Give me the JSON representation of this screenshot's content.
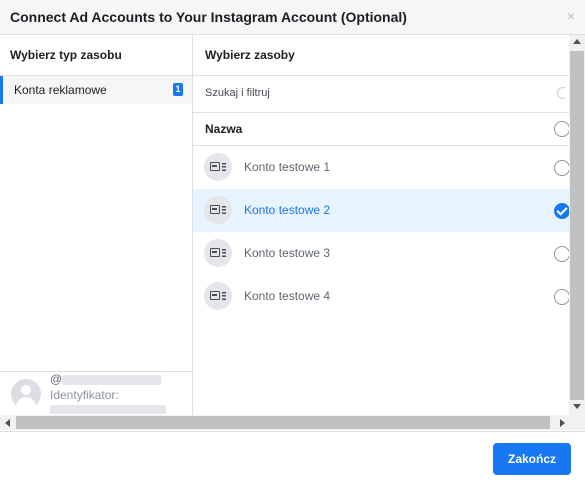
{
  "dialog": {
    "title": "Connect Ad Accounts to Your Instagram Account (Optional)",
    "close_icon": "×"
  },
  "left_panel": {
    "header": "Wybierz typ zasobu",
    "resource_types": [
      {
        "label": "Konta reklamowe",
        "count": "1",
        "selected": true
      }
    ],
    "profile": {
      "handle_prefix": "@",
      "id_label": "Identyfikator:"
    }
  },
  "right_panel": {
    "header": "Wybierz zasoby",
    "search_placeholder": "Szukaj i filtruj",
    "column_header": "Nazwa",
    "items": [
      {
        "name": "Konto testowe 1",
        "selected": false,
        "icon": "ad-account-icon"
      },
      {
        "name": "Konto testowe 2",
        "selected": true,
        "icon": "ad-account-icon"
      },
      {
        "name": "Konto testowe 3",
        "selected": false,
        "icon": "ad-account-icon"
      },
      {
        "name": "Konto testowe 4",
        "selected": false,
        "icon": "ad-account-icon"
      }
    ]
  },
  "footer": {
    "finish_label": "Zakończ"
  },
  "colors": {
    "accent": "#1877f2",
    "selected_row_bg": "#e7f3ff",
    "header_bg": "#f5f6f7"
  }
}
